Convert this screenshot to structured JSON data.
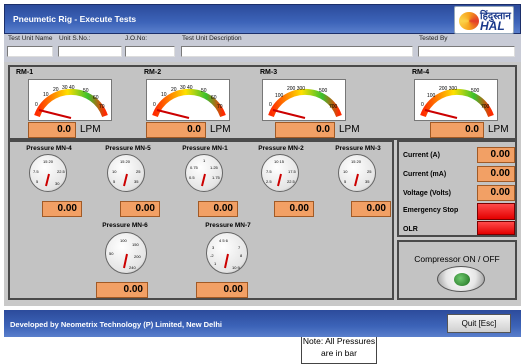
{
  "title": "Pneumetic Rig - Execute Tests",
  "logo": {
    "text_hindi": "हिंदुस्तान",
    "text_hal": "HAL"
  },
  "info": {
    "labels": [
      "Test Unit Name",
      "Unit S.No.:",
      "J.O.No:",
      "Test Unit Description",
      "Tested By"
    ],
    "values": [
      "",
      "",
      "",
      "",
      ""
    ]
  },
  "flow_meters": [
    {
      "label": "RM-1",
      "value": "0.0",
      "unit": "LPM",
      "ticks": [
        "0",
        "10",
        "20",
        "30",
        "40",
        "50",
        "60",
        "70"
      ]
    },
    {
      "label": "RM-2",
      "value": "0.0",
      "unit": "LPM",
      "ticks": [
        "0",
        "10",
        "20",
        "30",
        "40",
        "50",
        "60",
        "70"
      ]
    },
    {
      "label": "RM-3",
      "value": "0.0",
      "unit": "LPM",
      "ticks": [
        "0",
        "100",
        "200",
        "300",
        "500",
        "700"
      ]
    },
    {
      "label": "RM-4",
      "value": "0.0",
      "unit": "LPM",
      "ticks": [
        "0",
        "100",
        "200",
        "300",
        "500",
        "700"
      ]
    }
  ],
  "pressures_row1": [
    {
      "label": "Pressure MN-4",
      "value": "0.00",
      "ticks": [
        "15",
        "20",
        "22.5",
        "30",
        "35",
        "7.5",
        "10",
        "5"
      ]
    },
    {
      "label": "Pressure MN-5",
      "value": "0.00",
      "ticks": [
        "15",
        "20",
        "25",
        "30",
        "35",
        "40",
        "10",
        "5"
      ]
    },
    {
      "label": "Pressure MN-1",
      "value": "0.00",
      "ticks": [
        "1",
        "1.25",
        "1.5",
        "1.75",
        "0.75",
        "0.5",
        "0.25"
      ]
    },
    {
      "label": "Pressure MN-2",
      "value": "0.00",
      "ticks": [
        "10",
        "15",
        "17.5",
        "20",
        "22.5",
        "25",
        "7.5",
        "5",
        "2.5"
      ]
    },
    {
      "label": "Pressure MN-3",
      "value": "0.00",
      "ticks": [
        "15",
        "20",
        "25",
        "30",
        "35",
        "10",
        "5"
      ]
    }
  ],
  "pressures_row2": [
    {
      "label": "Pressure MN-6",
      "value": "0.00",
      "ticks": [
        "100",
        "150",
        "200",
        "240",
        "50"
      ]
    },
    {
      "label": "Pressure MN-7",
      "value": "0.00",
      "ticks": [
        "4",
        "5",
        "6",
        "7",
        "8",
        "9",
        "10",
        "3",
        "2",
        "1"
      ]
    }
  ],
  "note": "Note: All Pressures are in bar",
  "electrical": [
    {
      "label": "Current (A)",
      "value": "0.00"
    },
    {
      "label": "Current (mA)",
      "value": "0.00"
    },
    {
      "label": "Voltage (Volts)",
      "value": "0.00"
    }
  ],
  "indicators": [
    {
      "label": "Emergency Stop",
      "color": "#ff0000"
    },
    {
      "label": "OLR",
      "color": "#ff0000"
    }
  ],
  "compressor": {
    "label": "Compressor ON / OFF",
    "state_color": "#2e8b2e"
  },
  "footer": {
    "text": "Developed by   Neometrix Technology (P) Limited, New Delhi",
    "quit_label": "Quit [Esc]"
  }
}
